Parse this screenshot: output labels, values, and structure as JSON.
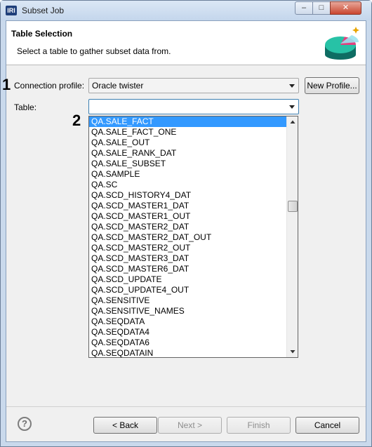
{
  "window": {
    "title": "Subset Job",
    "app_icon_text": "IRI",
    "minimize": "–",
    "maximize": "□",
    "close": "✕"
  },
  "header": {
    "title": "Table Selection",
    "description": "Select a table to gather subset data from."
  },
  "annotations": {
    "step1": "1",
    "step2": "2"
  },
  "connection": {
    "label": "Connection profile:",
    "value": "Oracle twister",
    "new_profile_label": "New Profile..."
  },
  "table": {
    "label": "Table:",
    "value": "",
    "options": [
      "QA.SALE_FACT",
      "QA.SALE_FACT_ONE",
      "QA.SALE_OUT",
      "QA.SALE_RANK_DAT",
      "QA.SALE_SUBSET",
      "QA.SAMPLE",
      "QA.SC",
      "QA.SCD_HISTORY4_DAT",
      "QA.SCD_MASTER1_DAT",
      "QA.SCD_MASTER1_OUT",
      "QA.SCD_MASTER2_DAT",
      "QA.SCD_MASTER2_DAT_OUT",
      "QA.SCD_MASTER2_OUT",
      "QA.SCD_MASTER3_DAT",
      "QA.SCD_MASTER6_DAT",
      "QA.SCD_UPDATE",
      "QA.SCD_UPDATE4_OUT",
      "QA.SENSITIVE",
      "QA.SENSITIVE_NAMES",
      "QA.SEQDATA",
      "QA.SEQDATA4",
      "QA.SEQDATA6",
      "QA.SEQDATAIN"
    ],
    "selected_index": 0
  },
  "footer": {
    "back_label": "< Back",
    "next_label": "Next >",
    "finish_label": "Finish",
    "cancel_label": "Cancel",
    "help_text": "?"
  }
}
